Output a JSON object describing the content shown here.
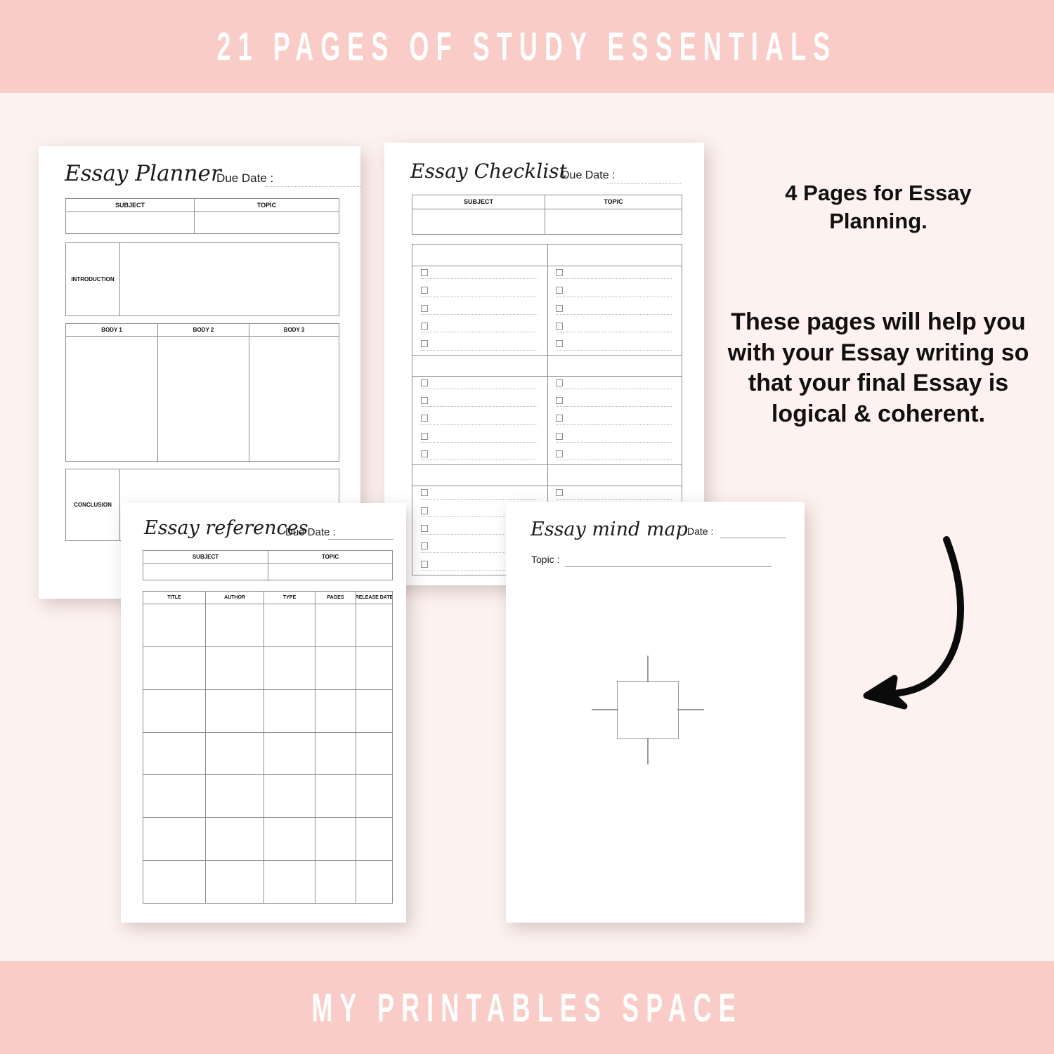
{
  "top_banner": {
    "text": "21 PAGES OF STUDY ESSENTIALS"
  },
  "bottom_banner": {
    "text": "MY PRINTABLES SPACE"
  },
  "promo": {
    "headline": "4 Pages for Essay Planning.",
    "body": "These pages will help you with your Essay writing so that your final Essay is logical & coherent."
  },
  "arrow": {
    "name": "curved-down-left-arrow",
    "color": "#0b0b0b"
  },
  "colors": {
    "banner_pink": "#f9ccc8",
    "page_background": "#fdf2ef",
    "sheet_white": "#ffffff",
    "rule_grey": "#8d8d8d",
    "text_black": "#101010"
  },
  "pages": [
    {
      "id": "essay-planner",
      "title": "Essay Planner",
      "date_label": "Due Date :",
      "date_value": "",
      "columns": [
        "SUBJECT",
        "TOPIC"
      ],
      "sections": [
        "INTRODUCTION",
        "CONCLUSION"
      ],
      "body_headers": [
        "BODY 1",
        "BODY 2",
        "BODY 3"
      ]
    },
    {
      "id": "essay-checklist",
      "title": "Essay Checklist",
      "date_label": "Due Date :",
      "date_value": "",
      "columns": [
        "SUBJECT",
        "TOPIC"
      ],
      "group_count": 3,
      "rows_per_group": 5,
      "columns_per_group": 2,
      "checkbox_icon": "empty-checkbox-icon"
    },
    {
      "id": "essay-references",
      "title": "Essay references",
      "date_label": "Due Date :",
      "date_value": "",
      "columns": [
        "SUBJECT",
        "TOPIC"
      ],
      "table_headers": [
        "TITLE",
        "AUTHOR",
        "TYPE",
        "PAGES",
        "RELEASE DATE"
      ],
      "table_row_count": 7
    },
    {
      "id": "essay-mind-map",
      "title": "Essay mind map",
      "date_label": "Date :",
      "date_value": "",
      "topic_label": "Topic :",
      "topic_value": "",
      "diagram": "central-node-with-four-branches"
    }
  ]
}
